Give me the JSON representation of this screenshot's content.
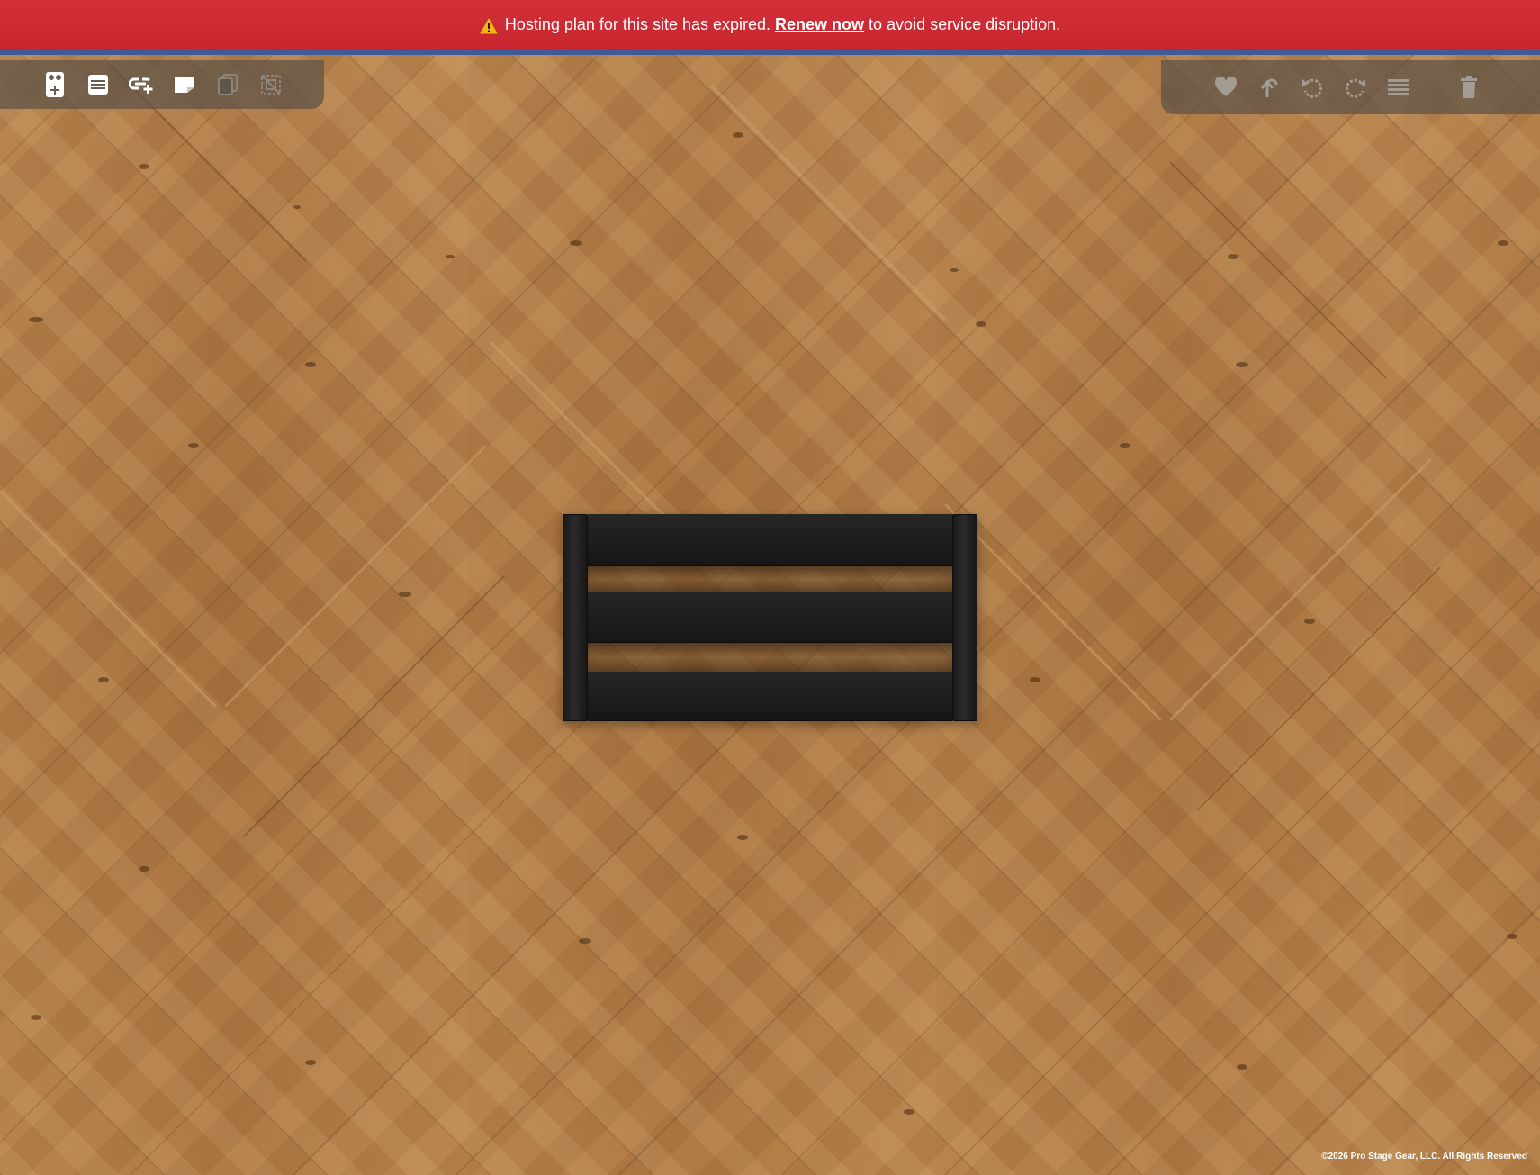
{
  "banner": {
    "prefix": "Hosting plan for this site has expired.",
    "link_label": "Renew now",
    "suffix": "to avoid service disruption.",
    "icon": "warning-triangle-icon",
    "background_color": "#c9282f",
    "accent_border_color": "#3d5a99"
  },
  "toolbar_left": {
    "buttons": [
      {
        "name": "add-pedal-button",
        "icon": "add-pedal-icon",
        "enabled": true
      },
      {
        "name": "add-pedalboard-button",
        "icon": "pedalboard-list-icon",
        "enabled": true
      },
      {
        "name": "add-patch-cable-button",
        "icon": "link-add-icon",
        "enabled": true
      },
      {
        "name": "save-button",
        "icon": "note-icon",
        "enabled": true
      },
      {
        "name": "duplicate-button",
        "icon": "copy-icon",
        "enabled": false
      },
      {
        "name": "deselect-button",
        "icon": "deselect-icon",
        "enabled": false
      }
    ]
  },
  "toolbar_right": {
    "buttons": [
      {
        "name": "favorite-button",
        "icon": "heart-icon",
        "enabled": false
      },
      {
        "name": "undo-button",
        "icon": "undo-icon",
        "enabled": false
      },
      {
        "name": "rotate-left-button",
        "icon": "rotate-left-icon",
        "enabled": false
      },
      {
        "name": "rotate-right-button",
        "icon": "rotate-right-icon",
        "enabled": false
      },
      {
        "name": "layers-button",
        "icon": "layers-icon",
        "enabled": false
      },
      {
        "name": "delete-button",
        "icon": "trash-icon",
        "enabled": false
      }
    ]
  },
  "canvas": {
    "floor": "herringbone-wood",
    "pedalboard_color": "#1e1e1e"
  },
  "footer": {
    "copyright": "©2026 Pro Stage Gear, LLC. All Rights Reserved"
  }
}
